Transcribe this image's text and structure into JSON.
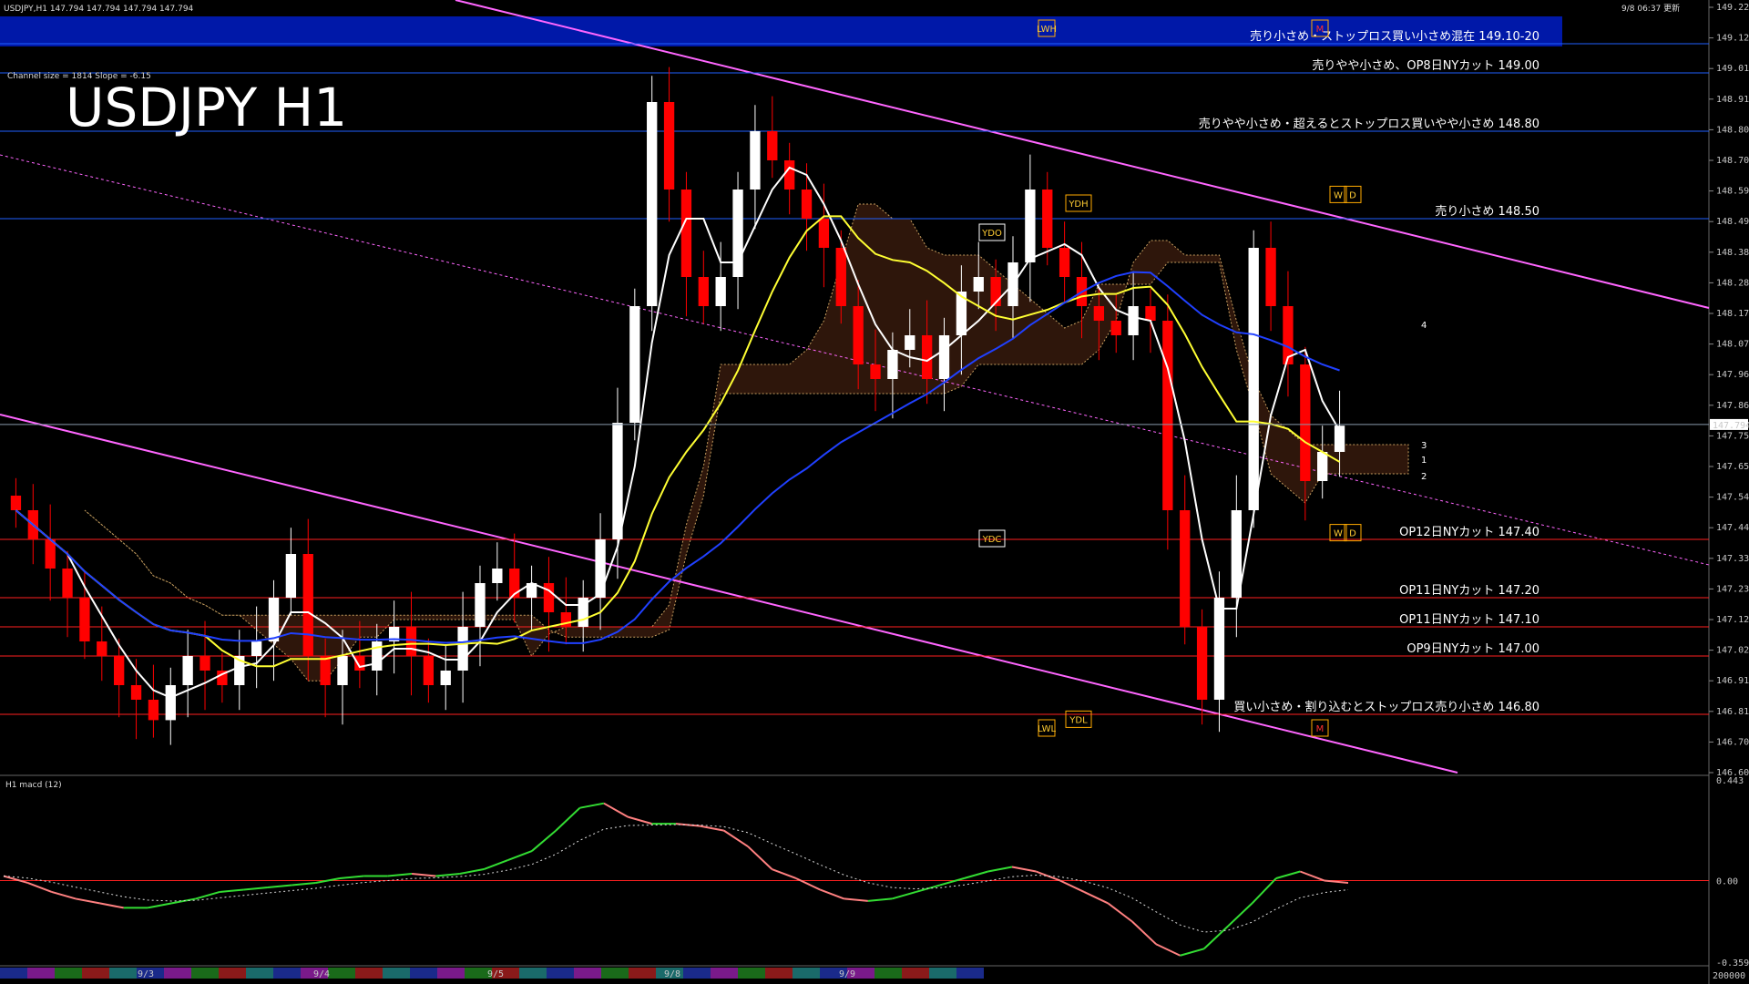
{
  "header": {
    "info": "USDJPY,H1  147.794 147.794 147.794 147.794",
    "timestamp": "9/8 06:37 更新",
    "channel_info": "Channel size = 1814 Slope = -6.15",
    "big_title": "USDJPY H1",
    "sub_label": "H1  macd (12)"
  },
  "colors": {
    "background": "#000000",
    "bull_candle": "#ffffff",
    "bear_candle": "#ff0000",
    "resistance_line": "#2060ff",
    "support_line": "#ff2020",
    "channel": "#ff66ff",
    "banner": "#0018a8",
    "macd_up": "#33dd33",
    "macd_down": "#ff8080"
  },
  "chart_data": [
    {
      "type": "candlestick",
      "symbol": "USDJPY",
      "timeframe": "H1",
      "ylim": [
        146.6,
        149.225
      ],
      "current_price": 147.794,
      "current_price_label": "147.794",
      "price_ticks": [
        "149.225",
        "149.120",
        "149.015",
        "148.910",
        "148.805",
        "148.700",
        "148.595",
        "148.490",
        "148.385",
        "148.280",
        "148.175",
        "148.070",
        "147.965",
        "147.860",
        "147.755",
        "147.650",
        "147.545",
        "147.440",
        "147.335",
        "147.230",
        "147.125",
        "147.020",
        "146.915",
        "146.810",
        "146.705",
        "146.600"
      ],
      "closes": [
        147.5,
        147.4,
        147.3,
        147.2,
        147.05,
        147.0,
        146.9,
        146.85,
        146.78,
        146.9,
        147.0,
        146.95,
        146.9,
        147.0,
        147.05,
        147.2,
        147.35,
        147.0,
        146.9,
        147.0,
        146.95,
        147.05,
        147.1,
        147.0,
        146.9,
        146.95,
        147.1,
        147.25,
        147.3,
        147.2,
        147.25,
        147.15,
        147.1,
        147.2,
        147.4,
        147.8,
        148.2,
        148.9,
        148.6,
        148.3,
        148.2,
        148.3,
        148.6,
        148.8,
        148.7,
        148.6,
        148.5,
        148.4,
        148.2,
        148.0,
        147.95,
        148.05,
        148.1,
        147.95,
        148.1,
        148.25,
        148.3,
        148.2,
        148.35,
        148.6,
        148.4,
        148.3,
        148.2,
        148.15,
        148.1,
        148.2,
        148.15,
        147.5,
        147.1,
        146.85,
        147.2,
        147.5,
        148.4,
        148.2,
        148.0,
        147.6,
        147.7,
        147.79
      ],
      "levels": [
        {
          "price": 149.1,
          "label": "売り小さめ・ストップロス買い小さめ混在 149.10-20",
          "color": "#2060ff",
          "side": "resistance"
        },
        {
          "price": 149.0,
          "label": "売りやや小さめ、OP8日NYカット 149.00",
          "color": "#2060ff",
          "side": "resistance"
        },
        {
          "price": 148.8,
          "label": "売りやや小さめ・超えるとストップロス買いやや小さめ 148.80",
          "color": "#2060ff",
          "side": "resistance"
        },
        {
          "price": 148.5,
          "label": "売り小さめ 148.50",
          "color": "#2060ff",
          "side": "resistance"
        },
        {
          "price": 147.4,
          "label": "OP12日NYカット 147.40",
          "color": "#ff2020",
          "side": "support"
        },
        {
          "price": 147.2,
          "label": "OP11日NYカット 147.20",
          "color": "#ff2020",
          "side": "support"
        },
        {
          "price": 147.1,
          "label": "OP11日NYカット 147.10",
          "color": "#ff2020",
          "side": "support"
        },
        {
          "price": 147.0,
          "label": "OP9日NYカット 147.00",
          "color": "#ff2020",
          "side": "support"
        },
        {
          "price": 146.8,
          "label": "買い小さめ・割り込むとストップロス売り小さめ 146.80",
          "color": "#ff2020",
          "side": "support"
        }
      ],
      "markers": [
        {
          "label": "LWH",
          "price": 149.15
        },
        {
          "label": "YDH",
          "price": 148.55
        },
        {
          "label": "YDO",
          "price": 148.45
        },
        {
          "label": "YDC",
          "price": 147.4
        },
        {
          "label": "YDL",
          "price": 146.78
        },
        {
          "label": "LWL",
          "price": 146.75
        },
        {
          "label": "W",
          "price": 148.58
        },
        {
          "label": "D",
          "price": 148.58
        },
        {
          "label": "W",
          "price": 147.42
        },
        {
          "label": "D",
          "price": 147.42
        },
        {
          "label": "M",
          "price": 149.15
        },
        {
          "label": "M",
          "price": 146.75
        }
      ],
      "projection_labels": [
        "4",
        "3",
        "1",
        "2"
      ]
    },
    {
      "type": "line",
      "name": "macd (12)",
      "ylim": [
        -0.359,
        0.443
      ],
      "ticks": [
        "0.443",
        "0.00",
        "-0.359"
      ],
      "values": [
        0.02,
        -0.01,
        -0.05,
        -0.08,
        -0.1,
        -0.12,
        -0.12,
        -0.1,
        -0.08,
        -0.05,
        -0.04,
        -0.03,
        -0.02,
        -0.01,
        0.01,
        0.02,
        0.02,
        0.03,
        0.02,
        0.03,
        0.05,
        0.09,
        0.13,
        0.22,
        0.32,
        0.34,
        0.28,
        0.25,
        0.25,
        0.24,
        0.22,
        0.15,
        0.05,
        0.01,
        -0.04,
        -0.08,
        -0.09,
        -0.08,
        -0.05,
        -0.02,
        0.01,
        0.04,
        0.06,
        0.04,
        0.0,
        -0.05,
        -0.1,
        -0.18,
        -0.28,
        -0.33,
        -0.3,
        -0.2,
        -0.1,
        0.01,
        0.04,
        0.0,
        -0.01
      ]
    }
  ],
  "date_labels": [
    "9/3",
    "9/4",
    "9/5",
    "9/8",
    "9/9"
  ],
  "bottom_volume_label": "200000"
}
